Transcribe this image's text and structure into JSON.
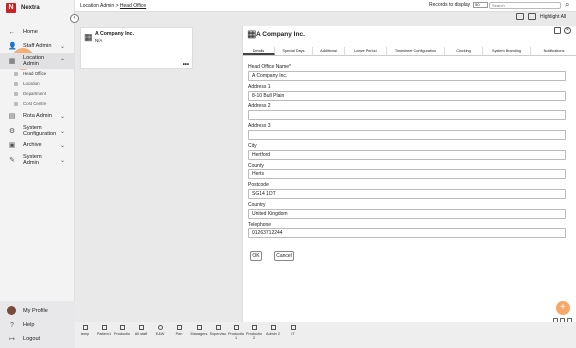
{
  "app": {
    "logo_letter": "N",
    "name": "Nextra"
  },
  "sidebar": {
    "collapse_icon": "chevron-left",
    "items": [
      {
        "label": "Home",
        "icon": "arrow-left"
      },
      {
        "label": "Staff Admin",
        "icon": "users"
      },
      {
        "label": "Location Admin",
        "icon": "building"
      },
      {
        "label": "Rota Admin",
        "icon": "calendar"
      },
      {
        "label": "System Configuration",
        "icon": "gear"
      },
      {
        "label": "Archive",
        "icon": "archive"
      },
      {
        "label": "System Admin",
        "icon": "wrench"
      }
    ],
    "sub_items": [
      {
        "label": "Head Office"
      },
      {
        "label": "Location"
      },
      {
        "label": "Department"
      },
      {
        "label": "Cost Centre"
      }
    ],
    "footer": [
      {
        "label": "My Profile"
      },
      {
        "label": "Help"
      },
      {
        "label": "Logout"
      }
    ]
  },
  "topbar": {
    "breadcrumb_root": "Location Admin",
    "breadcrumb_sep": " > ",
    "breadcrumb_current": "Head Office",
    "records_label": "Records to display",
    "records_value": "50",
    "search_placeholder": "Search"
  },
  "toolbar": {
    "highlight_label": "Highlight All"
  },
  "card": {
    "title": "A Company Inc.",
    "subtitle": "N/A",
    "more": "•••"
  },
  "panel": {
    "title": "A Company Inc.",
    "tabs": [
      "Details",
      "Special Days",
      "Additional",
      "Leave Period",
      "Timesheet Configuration",
      "Clocking",
      "System Branding",
      "Notifications"
    ],
    "fields": [
      {
        "label": "Head Office Name*",
        "value": "A Company Inc."
      },
      {
        "label": "Address 1",
        "value": "8-10 Bull Plain"
      },
      {
        "label": "Address 2",
        "value": ""
      },
      {
        "label": "Address 3",
        "value": ""
      },
      {
        "label": "City",
        "value": "Hertford"
      },
      {
        "label": "County",
        "value": "Herts"
      },
      {
        "label": "Postcode",
        "value": "SG14 1DT"
      },
      {
        "label": "Country",
        "value": "United Kingdom"
      },
      {
        "label": "Telephone",
        "value": "01263712244"
      }
    ],
    "ok_label": "OK",
    "cancel_label": "Cancel"
  },
  "fab_label": "+",
  "bottom_apps": [
    "temp",
    "Pattern1",
    "Productio",
    "All staff",
    "E&W",
    "Pan",
    "Managers",
    "Supervisc",
    "Productio 1",
    "Productio 2",
    "Admin 2",
    "IT"
  ],
  "colors": {
    "accent": "#f7a866",
    "brand": "#cc2222"
  }
}
